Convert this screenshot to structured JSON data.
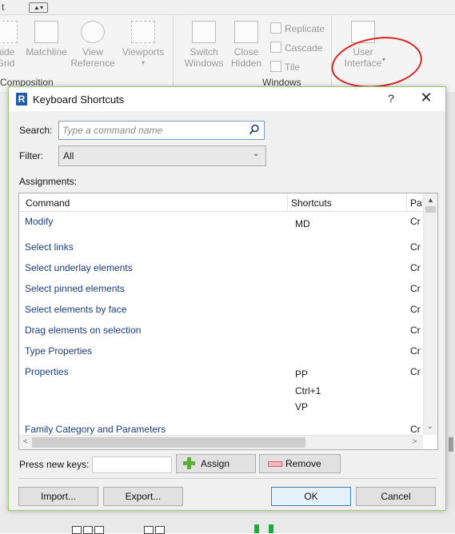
{
  "ribbon": {
    "top_text": "t",
    "groups": [
      {
        "label": "uide\nGrid"
      },
      {
        "label": "Matchline"
      },
      {
        "label": "View\nReference"
      },
      {
        "label": "Viewports"
      },
      {
        "label": "Switch\nWindows"
      },
      {
        "label": "Close\nHidden"
      },
      {
        "label": "User\nInterface"
      }
    ],
    "small_buttons": [
      "Replicate",
      "Cascade",
      "Tile"
    ],
    "panel_composition": "Composition",
    "panel_windows": "Windows"
  },
  "dialog": {
    "title": "Keyboard Shortcuts",
    "help": "?",
    "close": "✕",
    "search_label": "Search:",
    "search_placeholder": "Type a command name",
    "search_value": "",
    "filter_label": "Filter:",
    "filter_value": "All",
    "assignments_label": "Assignments:",
    "columns": [
      "Command",
      "Shortcuts",
      "Pa"
    ],
    "rows": [
      {
        "command": "Modify",
        "shortcuts": [
          "MD"
        ],
        "path": "Cr"
      },
      {
        "command": "Select links",
        "shortcuts": [],
        "path": "Cr"
      },
      {
        "command": "Select underlay elements",
        "shortcuts": [],
        "path": "Cr"
      },
      {
        "command": "Select pinned elements",
        "shortcuts": [],
        "path": "Cr"
      },
      {
        "command": "Select elements by face",
        "shortcuts": [],
        "path": "Cr"
      },
      {
        "command": "Drag elements on selection",
        "shortcuts": [],
        "path": "Cr"
      },
      {
        "command": "Type Properties",
        "shortcuts": [],
        "path": "Cr"
      },
      {
        "command": "Properties",
        "shortcuts": [
          "PP",
          "Ctrl+1",
          "VP"
        ],
        "path": "Cr"
      },
      {
        "command": "Family Category and Parameters",
        "shortcuts": [],
        "path": "Cr"
      }
    ],
    "press_keys_label": "Press new keys:",
    "assign_label": "Assign",
    "remove_label": "Remove",
    "import_label": "Import...",
    "export_label": "Export...",
    "ok_label": "OK",
    "cancel_label": "Cancel"
  },
  "colors": {
    "accent_border": "#9fc46a",
    "annotation": "#e0211d",
    "command_text": "#1c3c80"
  }
}
